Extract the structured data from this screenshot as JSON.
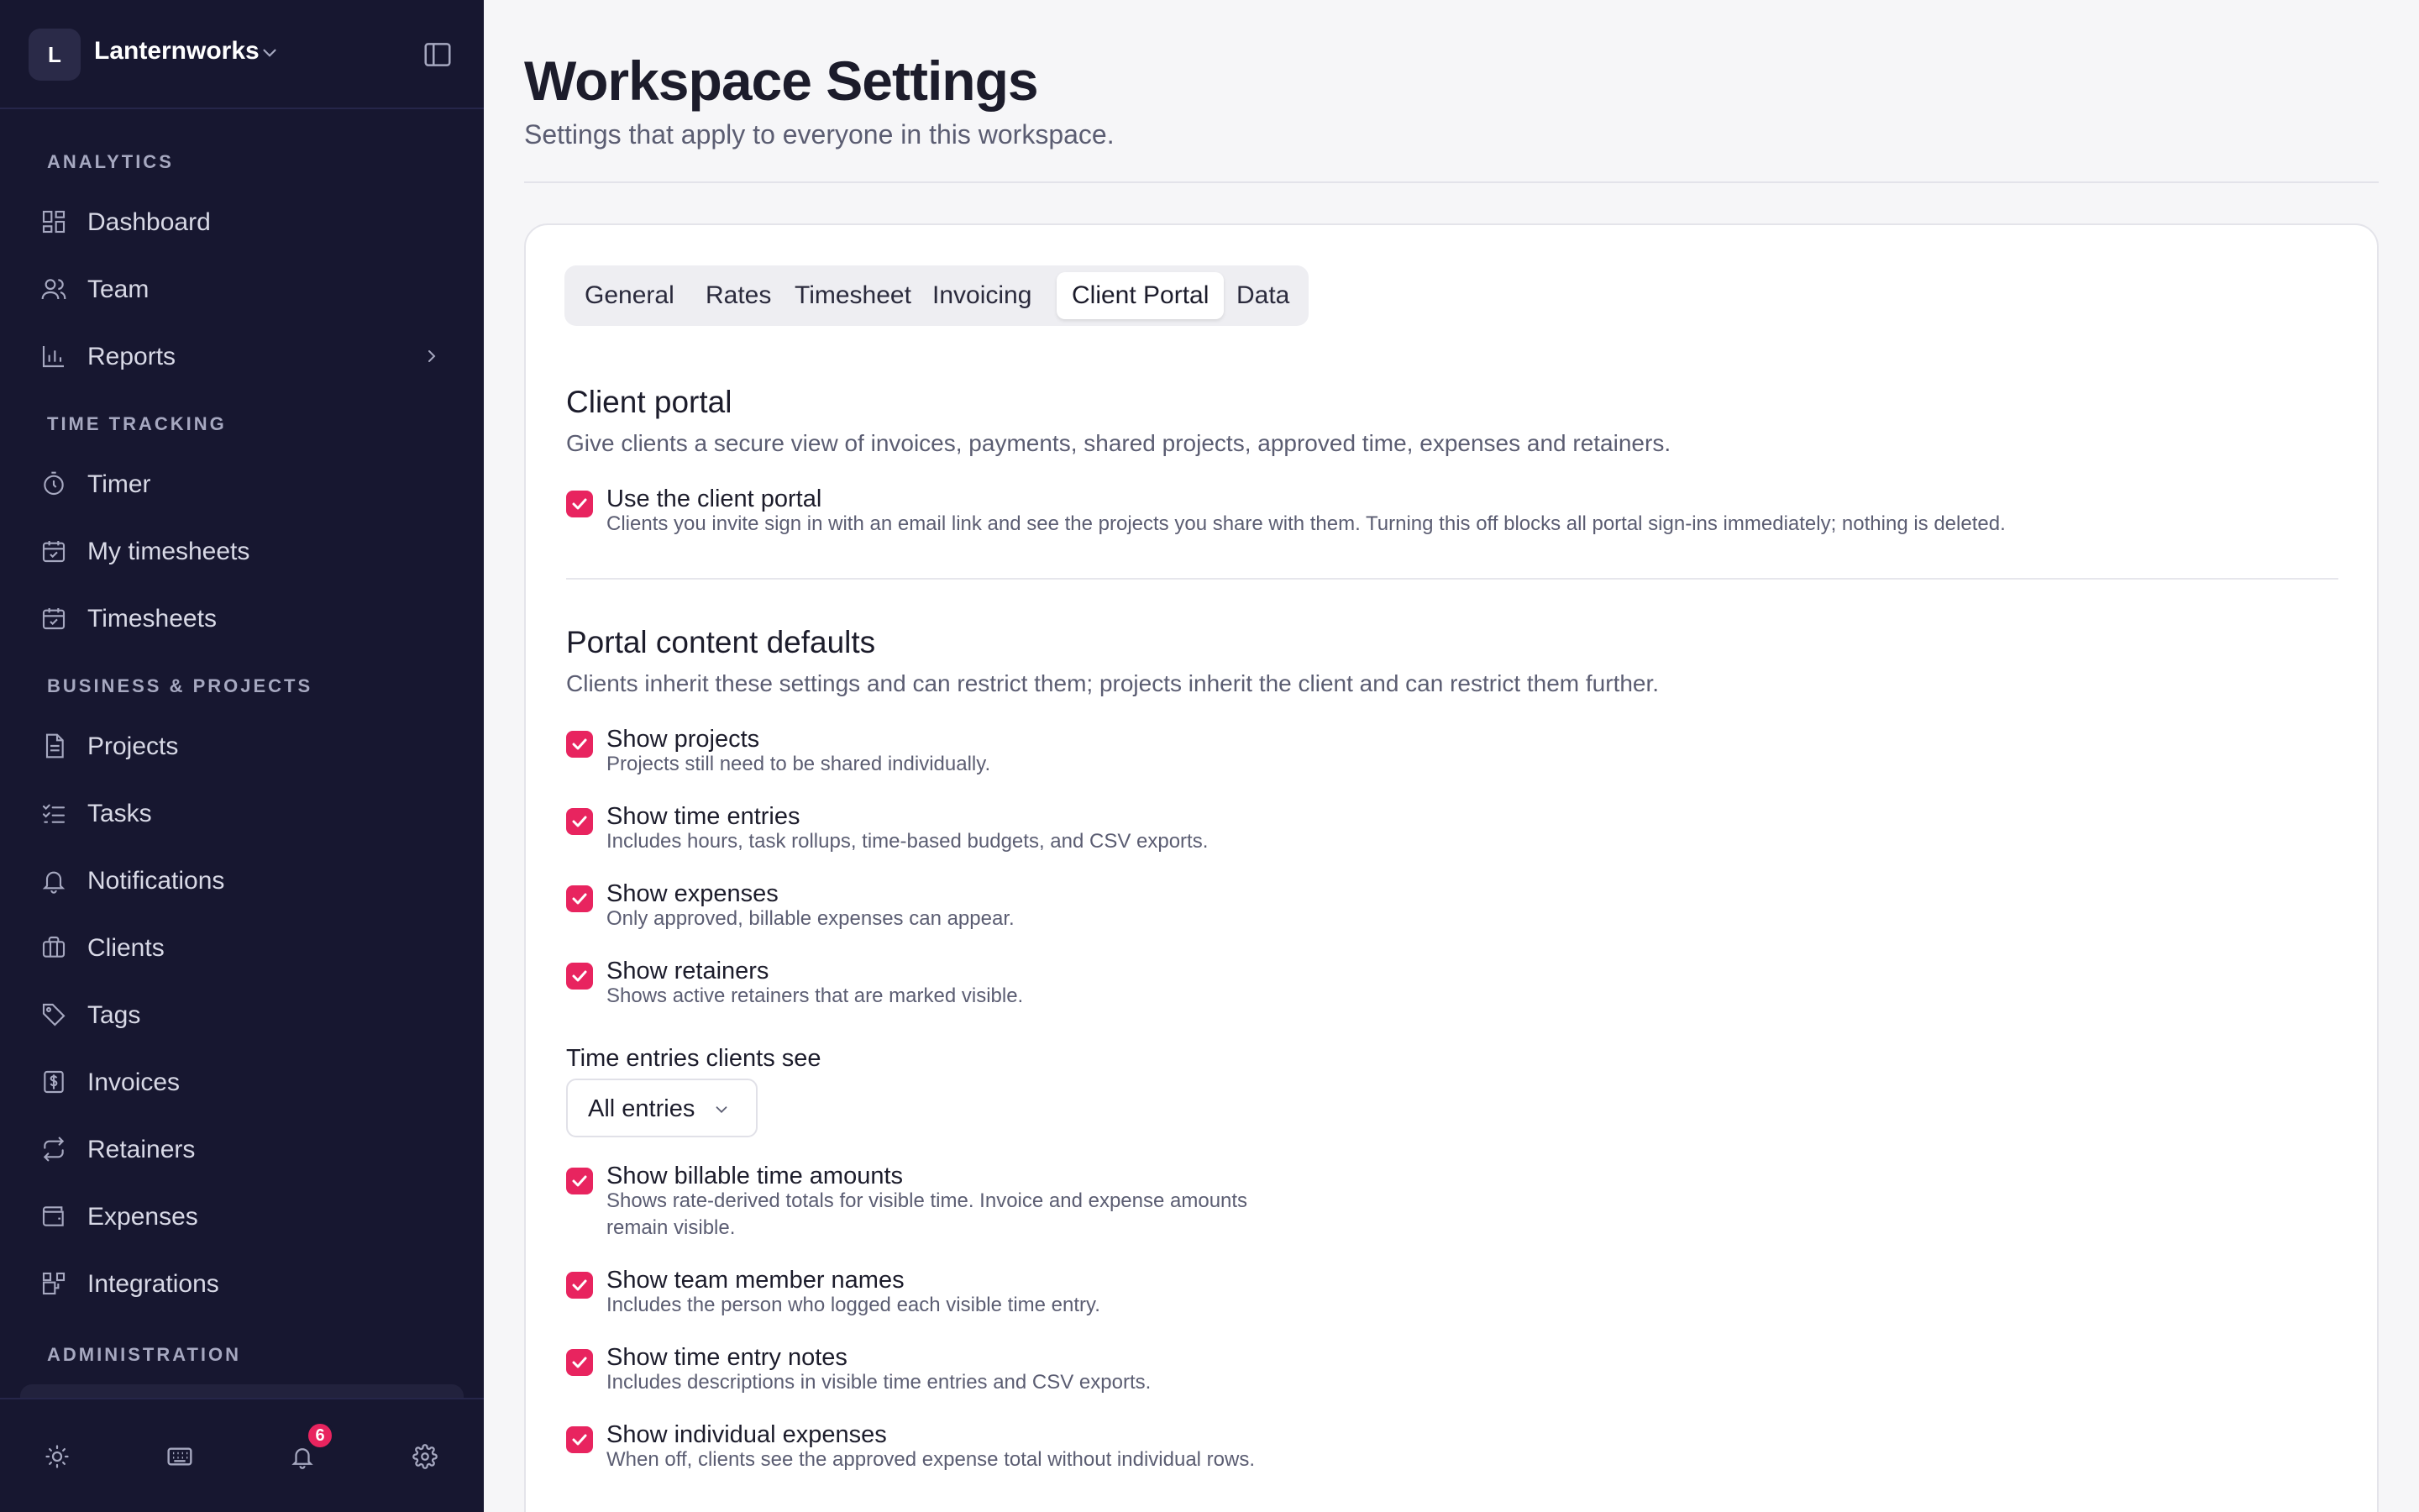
{
  "workspace": {
    "initial": "L",
    "name": "Lanternworks"
  },
  "sidebar": {
    "sections": [
      {
        "title": "ANALYTICS",
        "items": [
          {
            "label": "Dashboard",
            "icon": "dashboard-icon"
          },
          {
            "label": "Team",
            "icon": "team-icon"
          },
          {
            "label": "Reports",
            "icon": "reports-icon",
            "has_submenu": true
          }
        ]
      },
      {
        "title": "TIME TRACKING",
        "items": [
          {
            "label": "Timer",
            "icon": "timer-icon"
          },
          {
            "label": "My timesheets",
            "icon": "calendar-icon"
          },
          {
            "label": "Timesheets",
            "icon": "calendar-icon"
          }
        ]
      },
      {
        "title": "BUSINESS & PROJECTS",
        "items": [
          {
            "label": "Projects",
            "icon": "document-icon"
          },
          {
            "label": "Tasks",
            "icon": "tasks-icon"
          },
          {
            "label": "Notifications",
            "icon": "bell-icon"
          },
          {
            "label": "Clients",
            "icon": "briefcase-icon"
          },
          {
            "label": "Tags",
            "icon": "tag-icon"
          },
          {
            "label": "Invoices",
            "icon": "invoice-icon"
          },
          {
            "label": "Retainers",
            "icon": "repeat-icon"
          },
          {
            "label": "Expenses",
            "icon": "wallet-icon"
          },
          {
            "label": "Integrations",
            "icon": "integrations-icon"
          }
        ]
      },
      {
        "title": "ADMINISTRATION",
        "items": []
      }
    ],
    "footer": {
      "notification_count": "6"
    }
  },
  "page": {
    "title": "Workspace Settings",
    "subtitle": "Settings that apply to everyone in this workspace."
  },
  "tabs": [
    {
      "label": "General",
      "active": false
    },
    {
      "label": "Rates",
      "active": false
    },
    {
      "label": "Timesheet",
      "active": false
    },
    {
      "label": "Invoicing",
      "active": false
    },
    {
      "label": "Client Portal",
      "active": true
    },
    {
      "label": "Data",
      "active": false
    }
  ],
  "client_portal": {
    "title": "Client portal",
    "description": "Give clients a secure view of invoices, payments, shared projects, approved time, expenses and retainers.",
    "use_portal": {
      "label": "Use the client portal",
      "description": "Clients you invite sign in with an email link and see the projects you share with them. Turning this off blocks all portal sign-ins immediately; nothing is deleted.",
      "checked": true
    }
  },
  "content_defaults": {
    "title": "Portal content defaults",
    "description": "Clients inherit these settings and can restrict them; projects inherit the client and can restrict them further.",
    "options": [
      {
        "label": "Show projects",
        "description": "Projects still need to be shared individually.",
        "checked": true
      },
      {
        "label": "Show time entries",
        "description": "Includes hours, task rollups, time-based budgets, and CSV exports.",
        "checked": true
      },
      {
        "label": "Show expenses",
        "description": "Only approved, billable expenses can appear.",
        "checked": true
      },
      {
        "label": "Show retainers",
        "description": "Shows active retainers that are marked visible.",
        "checked": true
      }
    ],
    "time_entries_field": {
      "label": "Time entries clients see",
      "value": "All entries"
    },
    "more_options": [
      {
        "label": "Show billable time amounts",
        "description_line1": "Shows rate-derived totals for visible time. Invoice and expense amounts",
        "description_line2": "remain visible.",
        "checked": true
      },
      {
        "label": "Show team member names",
        "description": "Includes the person who logged each visible time entry.",
        "checked": true
      },
      {
        "label": "Show time entry notes",
        "description": "Includes descriptions in visible time entries and CSV exports.",
        "checked": true
      },
      {
        "label": "Show individual expenses",
        "description": "When off, clients see the approved expense total without individual rows.",
        "checked": true
      }
    ]
  },
  "colors": {
    "sidebar_bg": "#171730",
    "accent": "#e8245f",
    "page_bg": "#f6f6f8"
  }
}
